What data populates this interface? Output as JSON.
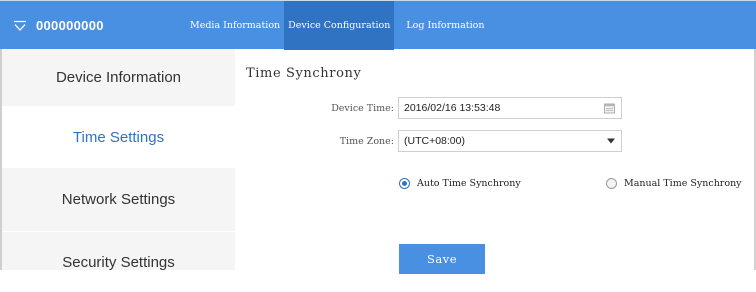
{
  "header": {
    "device_name": "000000000",
    "tabs": [
      {
        "label": "Media Information",
        "active": false
      },
      {
        "label": "Device Configuration",
        "active": true
      },
      {
        "label": "Log Information",
        "active": false
      }
    ],
    "colors": {
      "bar": "#4a90e2",
      "active_tab": "#2f73c2"
    }
  },
  "sidebar": {
    "items": [
      {
        "label": "Device Information",
        "active": false
      },
      {
        "label": "Time Settings",
        "active": true
      },
      {
        "label": "Network Settings",
        "active": false
      },
      {
        "label": "Security Settings",
        "active": false
      }
    ]
  },
  "main": {
    "title": "Time Synchrony",
    "device_time": {
      "label": "Device Time:",
      "value": "2016/02/16 13:53:48",
      "icon": "calendar-icon"
    },
    "time_zone": {
      "label": "Time Zone:",
      "value": "(UTC+08:00)",
      "icon": "dropdown-arrow-icon"
    },
    "sync_mode": {
      "options": [
        {
          "label": "Auto Time Synchrony",
          "selected": true
        },
        {
          "label": "Manual Time Synchrony",
          "selected": false
        }
      ]
    },
    "save_label": "Save"
  }
}
